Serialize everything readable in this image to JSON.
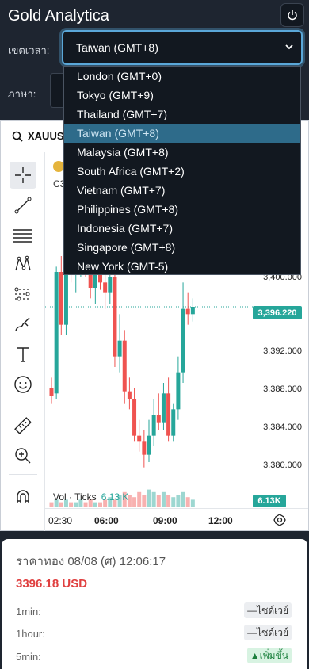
{
  "app": {
    "title": "Gold Analytica"
  },
  "settings": {
    "timezone_label": "เขตเวลา:",
    "timezone_selected": "Taiwan (GMT+8)",
    "language_label": "ภาษา:"
  },
  "timezone_options": [
    "London (GMT+0)",
    "Tokyo (GMT+9)",
    "Thailand (GMT+7)",
    "Taiwan (GMT+8)",
    "Malaysia (GMT+8)",
    "South Africa (GMT+2)",
    "Vietnam (GMT+7)",
    "Philippines (GMT+8)",
    "Indonesia (GMT+7)",
    "Singapore (GMT+8)",
    "New York (GMT-5)"
  ],
  "chart": {
    "symbol": "XAUUSD",
    "info_prefix": "C3",
    "price_axis": [
      "3,400.000",
      "3,392.000",
      "3,388.000",
      "3,384.000",
      "3,380.000"
    ],
    "current_price": "3,396.220",
    "volume_label": "Vol · Ticks",
    "volume_value": "6.13 K",
    "volume_tag": "6.13K",
    "time_axis": [
      "02:30",
      "06:00",
      "09:00",
      "12:00"
    ],
    "up_color": "#26a69a",
    "down_color": "#ef5350"
  },
  "chart_data": {
    "type": "bar",
    "title": "",
    "xlabel": "",
    "ylabel": "",
    "ylim": [
      3378.5,
      3402.5
    ],
    "x_ticks": [
      "02:30",
      "06:00",
      "09:00",
      "12:00"
    ],
    "candles": [
      {
        "o": 3388.5,
        "h": 3389.5,
        "l": 3387.0,
        "c": 3387.8
      },
      {
        "o": 3388.0,
        "h": 3400.0,
        "l": 3387.5,
        "c": 3399.5
      },
      {
        "o": 3399.5,
        "h": 3401.0,
        "l": 3393.5,
        "c": 3394.5
      },
      {
        "o": 3394.5,
        "h": 3400.5,
        "l": 3393.5,
        "c": 3400.0
      },
      {
        "o": 3400.0,
        "h": 3401.5,
        "l": 3398.5,
        "c": 3399.2
      },
      {
        "o": 3399.2,
        "h": 3401.8,
        "l": 3397.5,
        "c": 3400.0
      },
      {
        "o": 3400.0,
        "h": 3401.5,
        "l": 3399.0,
        "c": 3400.8
      },
      {
        "o": 3400.8,
        "h": 3402.0,
        "l": 3399.0,
        "c": 3399.5
      },
      {
        "o": 3399.5,
        "h": 3401.5,
        "l": 3397.0,
        "c": 3398.0
      },
      {
        "o": 3398.0,
        "h": 3401.2,
        "l": 3396.5,
        "c": 3400.0
      },
      {
        "o": 3400.0,
        "h": 3402.0,
        "l": 3397.8,
        "c": 3398.5
      },
      {
        "o": 3398.5,
        "h": 3400.5,
        "l": 3396.0,
        "c": 3397.5
      },
      {
        "o": 3397.5,
        "h": 3401.0,
        "l": 3396.5,
        "c": 3399.0
      },
      {
        "o": 3399.0,
        "h": 3401.0,
        "l": 3390.5,
        "c": 3391.5
      },
      {
        "o": 3391.5,
        "h": 3395.5,
        "l": 3390.0,
        "c": 3393.0
      },
      {
        "o": 3393.0,
        "h": 3394.0,
        "l": 3387.0,
        "c": 3388.2
      },
      {
        "o": 3388.2,
        "h": 3389.5,
        "l": 3386.5,
        "c": 3387.5
      },
      {
        "o": 3387.5,
        "h": 3388.5,
        "l": 3383.5,
        "c": 3384.0
      },
      {
        "o": 3384.0,
        "h": 3385.5,
        "l": 3382.5,
        "c": 3383.5
      },
      {
        "o": 3383.5,
        "h": 3384.5,
        "l": 3381.0,
        "c": 3382.2
      },
      {
        "o": 3382.2,
        "h": 3385.5,
        "l": 3381.5,
        "c": 3384.0
      },
      {
        "o": 3384.0,
        "h": 3387.5,
        "l": 3383.0,
        "c": 3386.0
      },
      {
        "o": 3386.0,
        "h": 3388.0,
        "l": 3384.5,
        "c": 3385.2
      },
      {
        "o": 3385.2,
        "h": 3389.0,
        "l": 3384.5,
        "c": 3388.0
      },
      {
        "o": 3388.0,
        "h": 3389.5,
        "l": 3383.5,
        "c": 3384.0
      },
      {
        "o": 3384.0,
        "h": 3387.0,
        "l": 3383.5,
        "c": 3386.5
      },
      {
        "o": 3386.5,
        "h": 3391.5,
        "l": 3385.5,
        "c": 3390.0
      },
      {
        "o": 3390.0,
        "h": 3398.5,
        "l": 3389.0,
        "c": 3396.0
      },
      {
        "o": 3396.0,
        "h": 3397.5,
        "l": 3394.5,
        "c": 3395.5
      },
      {
        "o": 3395.5,
        "h": 3397.0,
        "l": 3394.8,
        "c": 3396.2
      }
    ],
    "volume": [
      2,
      3,
      2,
      3,
      2,
      2,
      3,
      2,
      3,
      2,
      2,
      3,
      4,
      3,
      5,
      6,
      5,
      4,
      6,
      5,
      7,
      6,
      5,
      6,
      5,
      4,
      5,
      6,
      4,
      3
    ]
  },
  "price_card": {
    "title": "ราคาทอง 08/08 (ศ) 12:06:17",
    "price": "3396.18 USD",
    "rows": [
      {
        "label": "1min:",
        "badge": "—ไซด์เวย์"
      },
      {
        "label": "1hour:",
        "badge": "—ไซด์เวย์"
      },
      {
        "label": "5min:",
        "badge": "▲เพิ่มขึ้น"
      }
    ]
  }
}
